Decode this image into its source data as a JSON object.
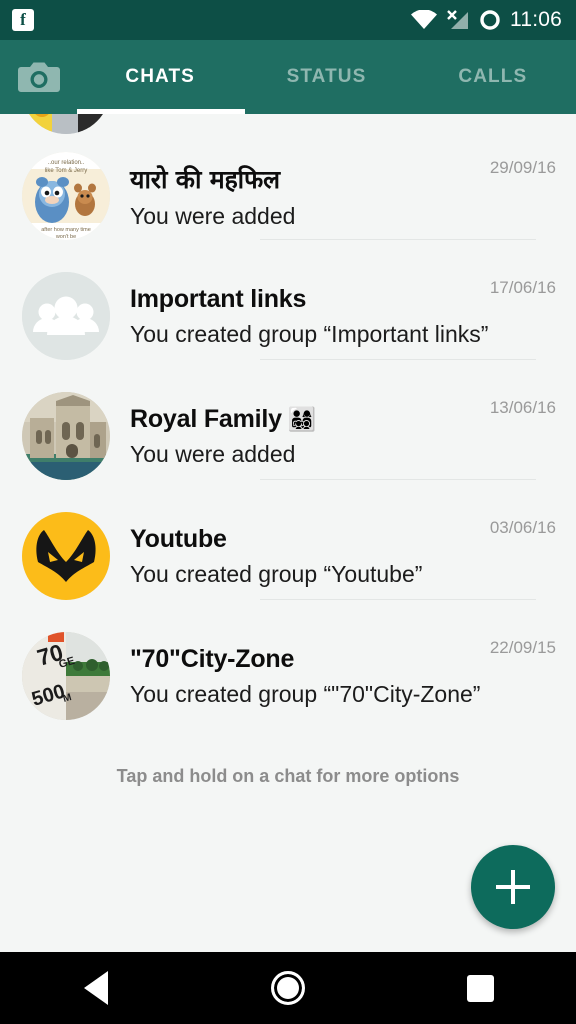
{
  "status_bar": {
    "notification_icon": "facebook-icon",
    "notification_letter": "f",
    "icons": [
      "wifi-icon",
      "cellular-no-signal-icon",
      "battery-ring-icon"
    ],
    "time": "11:06",
    "background_color": "#0d4f46"
  },
  "tab_bar": {
    "background_color": "#1f6e62",
    "camera_icon": "camera-icon",
    "tabs": [
      {
        "label": "CHATS",
        "active": true
      },
      {
        "label": "STATUS",
        "active": false
      },
      {
        "label": "CALLS",
        "active": false
      }
    ],
    "active_color": "#ffffff",
    "inactive_color": "#8fb7b0"
  },
  "chats": [
    {
      "title": "यारो की महफिल",
      "emoji": "",
      "subtitle": "You were added",
      "date": "29/09/16",
      "avatar": "tom-and-jerry-photo"
    },
    {
      "title": "Important links",
      "emoji": "",
      "subtitle": "You created group “Important links”",
      "date": "17/06/16",
      "avatar": "default-group-icon"
    },
    {
      "title": "Royal Family",
      "emoji": "👨‍👩‍👧‍👦",
      "subtitle": "You were added",
      "date": "13/06/16",
      "avatar": "palace-photo"
    },
    {
      "title": "Youtube",
      "emoji": "",
      "subtitle": "You created group “Youtube”",
      "date": "03/06/16",
      "avatar": "yellow-mask-logo"
    },
    {
      "title": "\"70\"City-Zone",
      "emoji": "",
      "subtitle": "You created group “\"70\"City-Zone”",
      "date": "22/09/15",
      "avatar": "milestone-photo"
    }
  ],
  "hint": {
    "text": "Tap and hold on a chat for more options"
  },
  "fab": {
    "icon": "plus-icon",
    "label": "New chat",
    "color": "#0d6b5c"
  },
  "nav_bar": {
    "buttons": [
      "back-icon",
      "home-icon",
      "recents-icon"
    ],
    "background_color": "#000000"
  }
}
